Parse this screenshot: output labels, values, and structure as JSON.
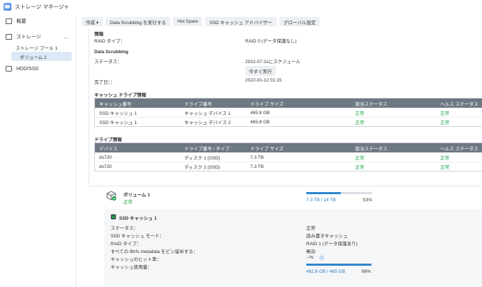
{
  "app": {
    "title": "ストレージ マネージャ",
    "icon": "storage-manager-icon"
  },
  "sidebar": {
    "overview": "概要",
    "storage": "ストレージ",
    "pool": "ストレージ プール 1",
    "volume": "ボリューム 1",
    "hdd": "HDD/SSD"
  },
  "toolbar": {
    "create": "作成 ▾",
    "scrub": "Data Scrubbing を実行する",
    "hotspare": "Hot Spare",
    "advisor": "SSD キャッシュ アドバイザー",
    "global": "グローバル設定"
  },
  "info": {
    "heading": "情報",
    "raid_label": "RAID タイプ：",
    "raid_value": "RAID 0 (データ保護なし)"
  },
  "scrubbing": {
    "heading": "Data Scrubbing",
    "status_label": "ステータス：",
    "status_value": "2022-07-11にスケジュール",
    "run_now": "今すぐ実行",
    "done_label": "完了日：：",
    "done_value": "2022-01-12 01:15"
  },
  "cache_drives": {
    "heading": "キャッシュ ドライブ情報",
    "columns": [
      "キャッシュ番号",
      "ドライブ番号",
      "ドライブ サイズ",
      "割当ステータス",
      "ヘルス ステータス"
    ],
    "rows": [
      [
        "SSD キャッシュ 1",
        "キャッシュ デバイス 1",
        "465.8 GB",
        "正常",
        "正常"
      ],
      [
        "SSD キャッシュ 1",
        "キャッシュ デバイス 2",
        "465.8 GB",
        "正常",
        "正常"
      ]
    ]
  },
  "drives": {
    "heading": "ドライブ情報",
    "columns": [
      "デバイス",
      "ドライブ番号 / タイプ",
      "ドライブ サイズ",
      "割当ステータス",
      "ヘルス ステータス"
    ],
    "rows": [
      [
        "ds720",
        "ディスク 1 (SSD)",
        "7.3 TB",
        "正常",
        "正常"
      ],
      [
        "ds720",
        "ディスク 2 (SSD)",
        "7.3 TB",
        "正常",
        "正常"
      ]
    ]
  },
  "volume": {
    "name": "ボリューム 1",
    "status": "正常",
    "usage": "7.3 TB / 14 TB",
    "percent": "53%",
    "fill_fraction": 0.53
  },
  "ssd_cache": {
    "title": "SSD キャッシュ 1",
    "status_label": "ステータス：",
    "status_value": "正常",
    "mode_label": "SSD キャッシュ モード：",
    "mode_value": "読み書きキャッシュ",
    "raid_label": "RAID タイプ：",
    "raid_value": "RAID 1 (データ保護あり)",
    "btrfs_label": "すべての Btrfs metadata をピン留めする：",
    "btrfs_value": "無効",
    "hit_label": "キャッシュのヒット率：",
    "hit_value": "--%",
    "usage_label": "キャッシュ使用量：",
    "usage_value": "462.6 GB / 465 GB",
    "usage_percent": "99%",
    "usage_fraction": 0.99
  },
  "colors": {
    "accent": "#2f86d0",
    "ok": "#1aa34a",
    "table_header": "#6e7884"
  }
}
